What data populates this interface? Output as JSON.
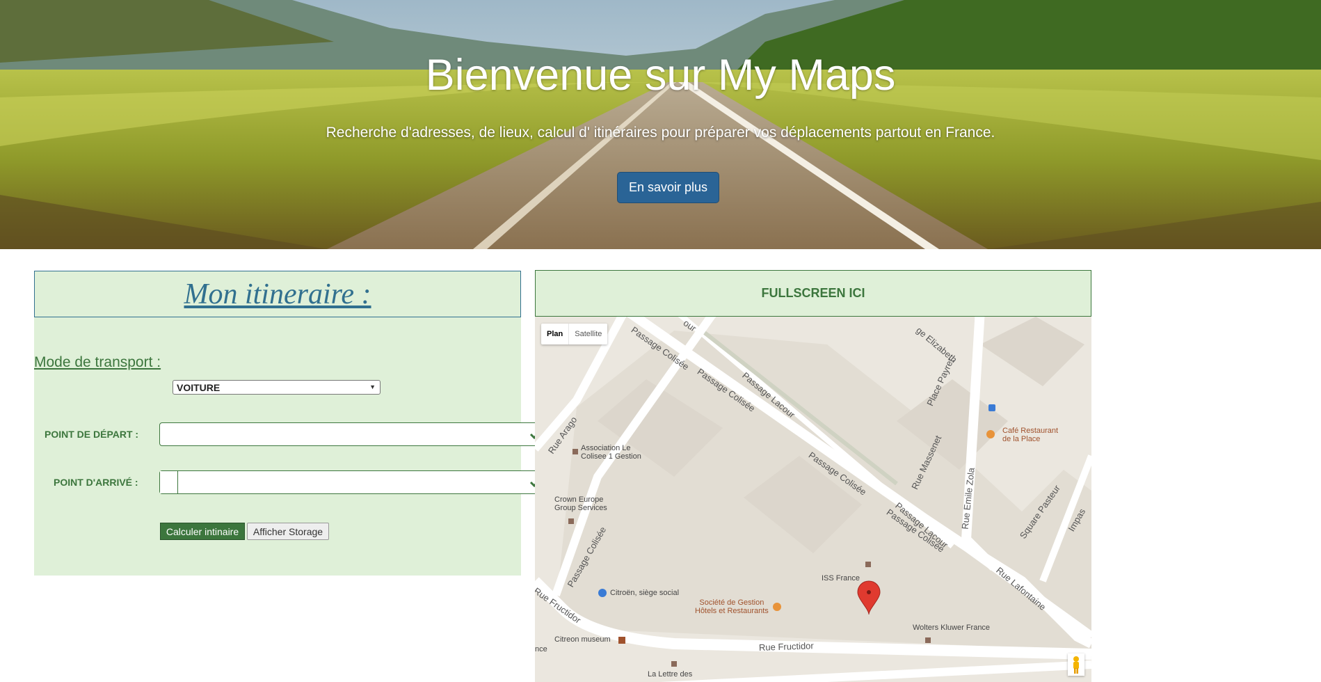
{
  "hero": {
    "title": "Bienvenue sur My Maps",
    "subtitle": "Recherche d'adresses, de lieux, calcul d' itinéraires pour préparer vos déplacements partout en France.",
    "cta_label": "En savoir plus"
  },
  "itinerary": {
    "title": "Mon itineraire :",
    "mode_label": "Mode de transport :",
    "mode_selected": "VOITURE",
    "departure_label": "POINT DE DÉPART :",
    "departure_value": "",
    "arrival_label": "POINT D'ARRIVÉ :",
    "arrival_value": "",
    "calc_button": "Calculer intinaire",
    "storage_button": "Afficher Storage"
  },
  "map": {
    "fullscreen_label": "FULLSCREEN ICI",
    "type_plan": "Plan",
    "type_satellite": "Satellite",
    "streets": {
      "passage_colisee_1": "Passage Colisée",
      "passage_colisee_2": "Passage Colisée",
      "passage_colisee_3": "Passage Colisée",
      "passage_colisee_4": "Passage Colisée",
      "passage_colisee_5": "Passage Colisée",
      "passage_lacour_1": "Passage Lacour",
      "passage_lacour_2": "Passage Lacour",
      "rue_arago": "Rue Arago",
      "rue_fructidor_1": "Rue Fructidor",
      "rue_fructidor_2": "Rue Fructidor",
      "rue_emile_zola": "Rue Emile Zola",
      "rue_massenet": "Rue Massenet",
      "rue_lafontaine": "Rue Lafontaine",
      "place_payret": "Place Payret",
      "square_pasteur": "Square Pasteur",
      "impasse": "Impas",
      "elizabeth": "ge Elizabeth",
      "top_partial": "our"
    },
    "pois": {
      "association": "Association Le\nColisee 1 Gestion",
      "crown": "Crown Europe\nGroup Services",
      "citroen": "Citroën, siège social",
      "societe": "Société de Gestion\nHôtels et Restaurants",
      "iss": "ISS France",
      "wolters": "Wolters Kluwer France",
      "cafe": "Café Restaurant\nde la Place",
      "museum": "Citreon museum",
      "lettre": "La Lettre des",
      "nce": "nce"
    }
  },
  "colors": {
    "panel_bg": "#dff0d8",
    "panel_text": "#3c763d",
    "title_blue": "#31708f",
    "cta_bg": "#2a6496"
  }
}
